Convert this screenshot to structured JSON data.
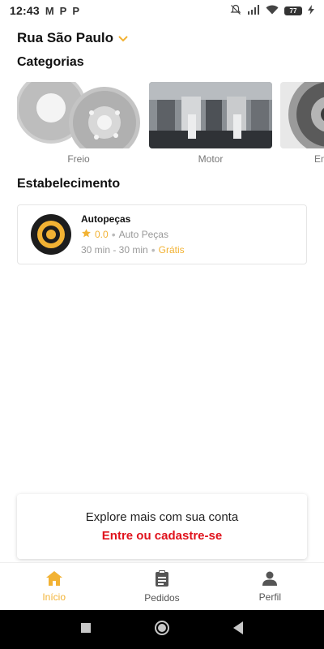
{
  "statusbar": {
    "time": "12:43",
    "app_icons": [
      "M",
      "P",
      "P"
    ],
    "battery": "77"
  },
  "address": {
    "label": "Rua São Paulo",
    "icon": "chevron-down-icon"
  },
  "categories": {
    "title": "Categorias",
    "items": [
      {
        "label": "Freio"
      },
      {
        "label": "Motor"
      },
      {
        "label": "Em"
      }
    ]
  },
  "establishments": {
    "title": "Estabelecimento",
    "items": [
      {
        "name": "Autopeças",
        "rating": "0.0",
        "category": "Auto Peças",
        "time": "30 min - 30 min",
        "delivery": "Grátis"
      }
    ]
  },
  "promo": {
    "text": "Explore mais com sua conta",
    "link": "Entre ou cadastre-se"
  },
  "bottom_nav": [
    {
      "label": "Início",
      "icon": "home-icon",
      "active": true
    },
    {
      "label": "Pedidos",
      "icon": "clipboard-icon",
      "active": false
    },
    {
      "label": "Perfil",
      "icon": "person-icon",
      "active": false
    }
  ],
  "colors": {
    "accent": "#f2b233",
    "link": "#e0121c"
  }
}
